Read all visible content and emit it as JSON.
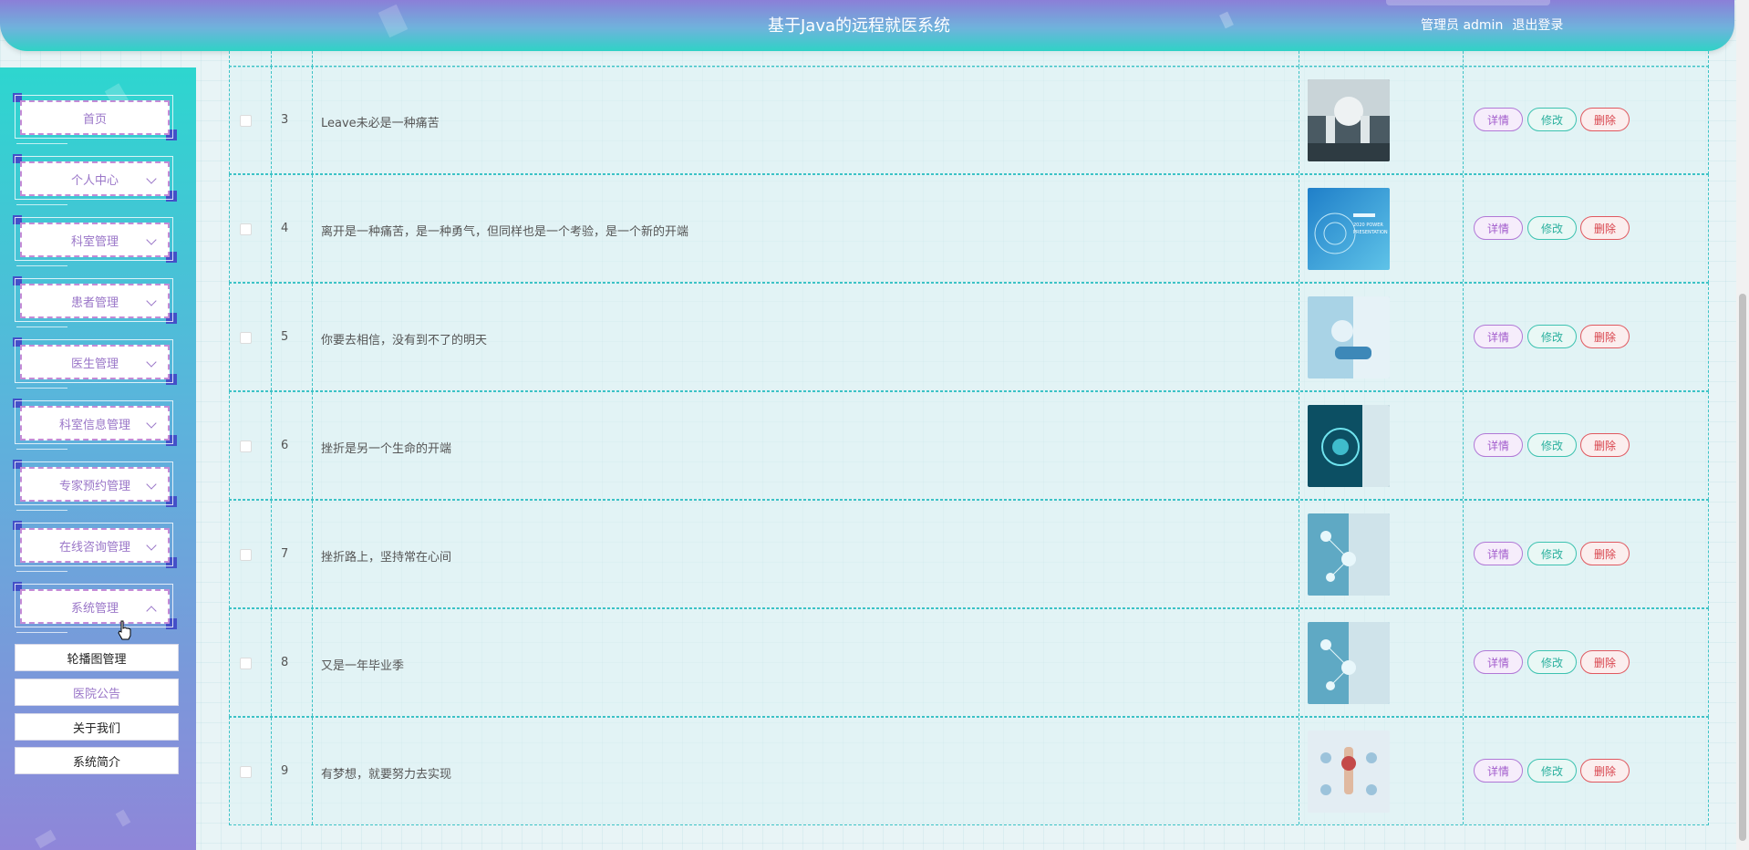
{
  "header": {
    "title": "基于Java的远程就医系统",
    "role": "管理员 admin",
    "logout": "退出登录"
  },
  "sidebar": {
    "items": [
      {
        "label": "首页",
        "has_arrow": false
      },
      {
        "label": "个人中心",
        "has_arrow": true
      },
      {
        "label": "科室管理",
        "has_arrow": true
      },
      {
        "label": "患者管理",
        "has_arrow": true
      },
      {
        "label": "医生管理",
        "has_arrow": true
      },
      {
        "label": "科室信息管理",
        "has_arrow": true
      },
      {
        "label": "专家预约管理",
        "has_arrow": true
      },
      {
        "label": "在线咨询管理",
        "has_arrow": true
      },
      {
        "label": "系统管理",
        "has_arrow": true,
        "expanded": true
      }
    ],
    "subitems": [
      {
        "label": "轮播图管理",
        "active": false
      },
      {
        "label": "医院公告",
        "active": true
      },
      {
        "label": "关于我们",
        "active": false
      },
      {
        "label": "系统简介",
        "active": false
      }
    ]
  },
  "table": {
    "rows": [
      {
        "index": "3",
        "title": "Leave未必是一种痛苦",
        "image": "robot-surgery-icon"
      },
      {
        "index": "4",
        "title": "离开是一种痛苦，是一种勇气，但同样也是一个考验，是一个新的开端",
        "image": "presentation-cover-icon"
      },
      {
        "index": "5",
        "title": "你要去相信，没有到不了的明天",
        "image": "doctor-touch-icon"
      },
      {
        "index": "6",
        "title": "挫折是另一个生命的开端",
        "image": "doctor-hologram-icon"
      },
      {
        "index": "7",
        "title": "挫折路上，坚持常在心间",
        "image": "medical-network-icon"
      },
      {
        "index": "8",
        "title": "又是一年毕业季",
        "image": "medical-network-icon"
      },
      {
        "index": "9",
        "title": "有梦想，就要努力去实现",
        "image": "stethoscope-icon"
      }
    ],
    "buttons": {
      "detail": "详情",
      "edit": "修改",
      "delete": "删除"
    }
  },
  "thumb_texts": {
    "presentation_line1": "2020 POWER",
    "presentation_line2": "PRESENTATION"
  },
  "colors": {
    "accent_purple": "#9a76c8",
    "accent_teal": "#2fd2c6",
    "delete_red": "#d8434c"
  }
}
